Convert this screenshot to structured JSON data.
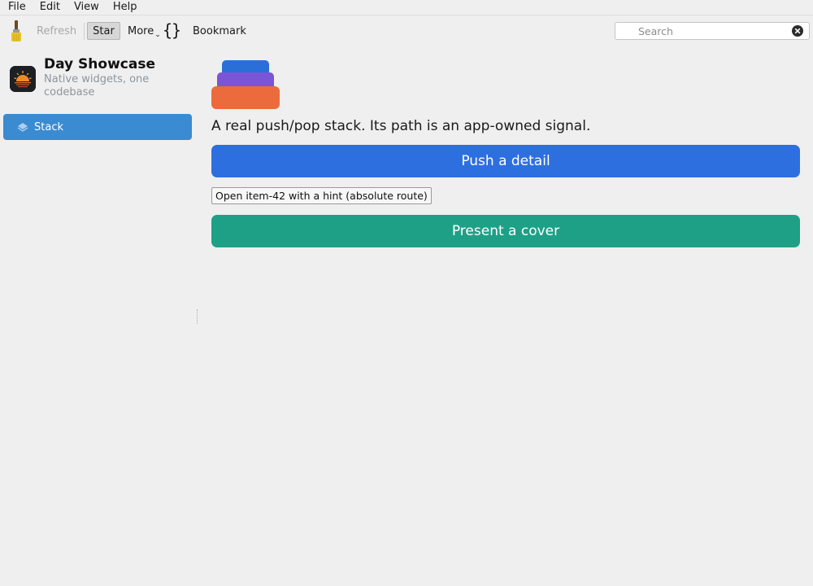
{
  "menu": {
    "items": [
      "File",
      "Edit",
      "View",
      "Help"
    ]
  },
  "toolbar": {
    "brush_icon": "paintbrush-icon",
    "refresh_label": "Refresh",
    "star_label": "Star",
    "more_label": "More",
    "more_caret": "⌄",
    "braces_label": "{}",
    "bookmark_label": "Bookmark"
  },
  "search": {
    "placeholder": "Search",
    "value": ""
  },
  "sidebar": {
    "app_title": "Day Showcase",
    "app_subtitle": "Native widgets, one codebase",
    "items": [
      {
        "label": "Stack",
        "icon": "layers-icon",
        "selected": true
      }
    ]
  },
  "main": {
    "description": "A real push/pop stack. Its path is an app-owned signal.",
    "push_button_label": "Push a detail",
    "open_button_label": "Open item-42 with a hint (absolute route)",
    "cover_button_label": "Present a cover"
  },
  "colors": {
    "accent_blue": "#2e6fe0",
    "teal": "#1ea087",
    "sidebar_selected": "#3a8bd1",
    "stack_top": "#2a6fd8",
    "stack_mid": "#7c55d6",
    "stack_bottom": "#ec6b3c"
  }
}
